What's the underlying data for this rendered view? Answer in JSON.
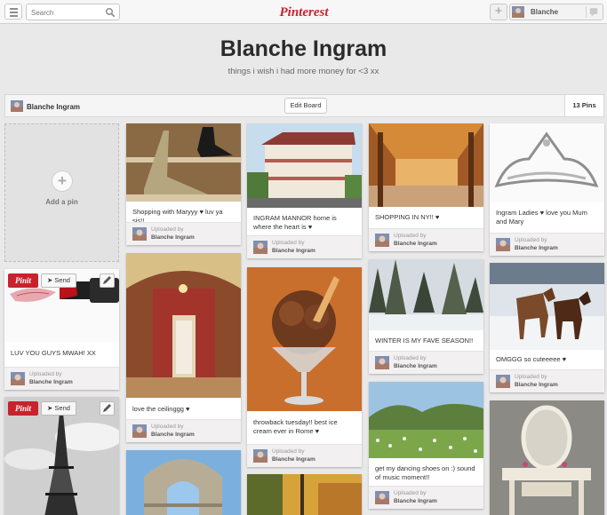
{
  "topbar": {
    "search_placeholder": "Search",
    "logo_text": "Pinterest",
    "user_name": "Blanche",
    "add_label": "+"
  },
  "board": {
    "title": "Blanche Ingram",
    "description": "things i wish i had more money for <3 xx",
    "owner": "Blanche Ingram",
    "edit_label": "Edit Board",
    "pins_count": "13 Pins"
  },
  "add_pin": {
    "label": "Add a pin"
  },
  "pin_actions": {
    "pinit": "Pinit",
    "send": "Send"
  },
  "attribution": {
    "uploaded_by": "Uploaded by",
    "user": "Blanche Ingram"
  },
  "pins": [
    {
      "id": "lipstick",
      "caption": "LUV YOU GUYS MWAH! XX"
    },
    {
      "id": "eiffel",
      "caption": ""
    },
    {
      "id": "shoes",
      "caption": "Shopping with Maryyy ♥ luv ya sis!!"
    },
    {
      "id": "ceiling",
      "caption": "love the ceilinggg ♥"
    },
    {
      "id": "gate",
      "caption": ""
    },
    {
      "id": "manor",
      "caption": "INGRAM MANNOR home is where the heart is ♥"
    },
    {
      "id": "icecream",
      "caption": "throwback tuesday!! best ice cream ever in Rome ♥"
    },
    {
      "id": "autumn",
      "caption": ""
    },
    {
      "id": "mall",
      "caption": "SHOPPING IN NY!! ♥"
    },
    {
      "id": "winter",
      "caption": "WINTER IS MY FAVE SEASON!!"
    },
    {
      "id": "meadow",
      "caption": "get my dancing shoes on :) sound of music moment!!"
    },
    {
      "id": "tiara",
      "caption": "Ingram Ladies ♥ love you Mum and Mary"
    },
    {
      "id": "horses",
      "caption": "OMGGG so cuteeeee ♥"
    },
    {
      "id": "vanity",
      "caption": ""
    }
  ],
  "colors": {
    "pinterest_red": "#c8232c",
    "background": "#e9e9e9"
  }
}
